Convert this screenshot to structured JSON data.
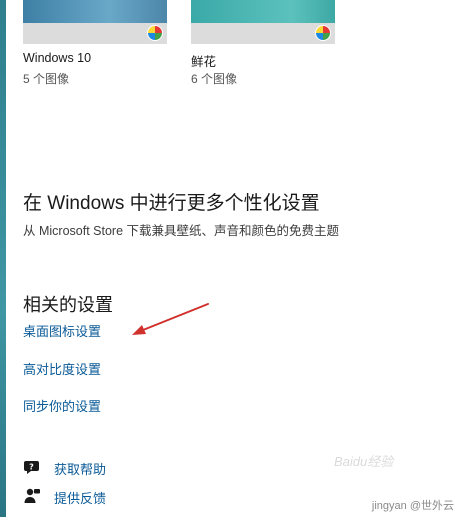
{
  "themes": [
    {
      "name": "Windows 10",
      "count": "5 个图像"
    },
    {
      "name": "鲜花",
      "count": "6 个图像"
    }
  ],
  "more_personalization": {
    "title": "在 Windows 中进行更多个性化设置",
    "description": "从 Microsoft Store 下载兼具壁纸、声音和颜色的免费主题"
  },
  "related_settings": {
    "title": "相关的设置",
    "links": [
      {
        "label": "桌面图标设置"
      },
      {
        "label": "高对比度设置"
      },
      {
        "label": "同步你的设置"
      }
    ]
  },
  "help": {
    "items": [
      {
        "label": "获取帮助",
        "icon": "help-chat-icon"
      },
      {
        "label": "提供反馈",
        "icon": "feedback-icon"
      }
    ]
  },
  "annotation": {
    "color": "#d0312d"
  },
  "colors": {
    "link": "#0a5a97",
    "accent_teal": "#3f96a4"
  },
  "watermark": {
    "logo": "Baidu经验",
    "text": "jingyan  @世外云"
  }
}
